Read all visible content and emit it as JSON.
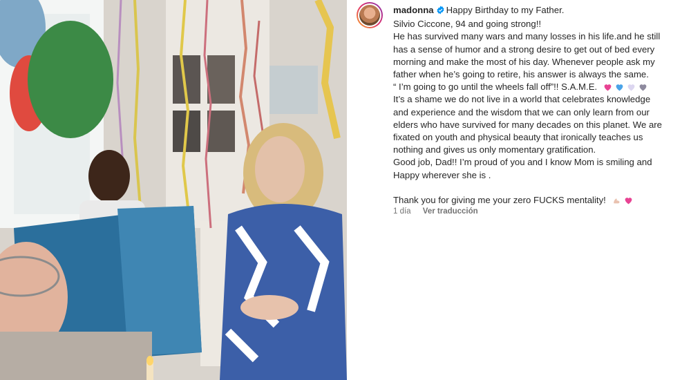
{
  "post": {
    "username": "madonna",
    "caption_lines": [
      "Happy Birthday to my Father.",
      "Silvio Ciccone, 94 and going strong!!",
      "He has survived many wars and many losses in his life.and he still",
      "has a sense of humor and a strong desire to get out of bed every",
      "morning and make the most of his day. Whenever people ask my",
      "father when he’s going to retire, his answer is always the same.",
      "“ I’m going to go until the wheels fall off”!! S.A.M.E.",
      "It’s a shame we do not live in a world that celebrates knowledge",
      "and experience and the wisdom that we can only learn from our",
      "elders who have survived for many decades on this planet. We are",
      "fixated on youth and physical beauty that ironically teaches us",
      "nothing and gives us only momentary gratification.",
      "Good job, Dad!! I’m proud of you and I know Mom is smiling and",
      "Happy wherever she is .",
      "",
      "Thank you for giving me your zero FUCKS mentality!"
    ],
    "time_ago": "1 día",
    "translate_label": "Ver traducción",
    "emoji_hearts": [
      "#e84393",
      "#4aa3e8",
      "#dcd6f0",
      "#8e8a9e"
    ],
    "emoji_end": [
      "flexed-biceps",
      "#e84393"
    ]
  },
  "colors": {
    "text": "#262626",
    "muted": "#737373",
    "verified": "#0095f6"
  }
}
